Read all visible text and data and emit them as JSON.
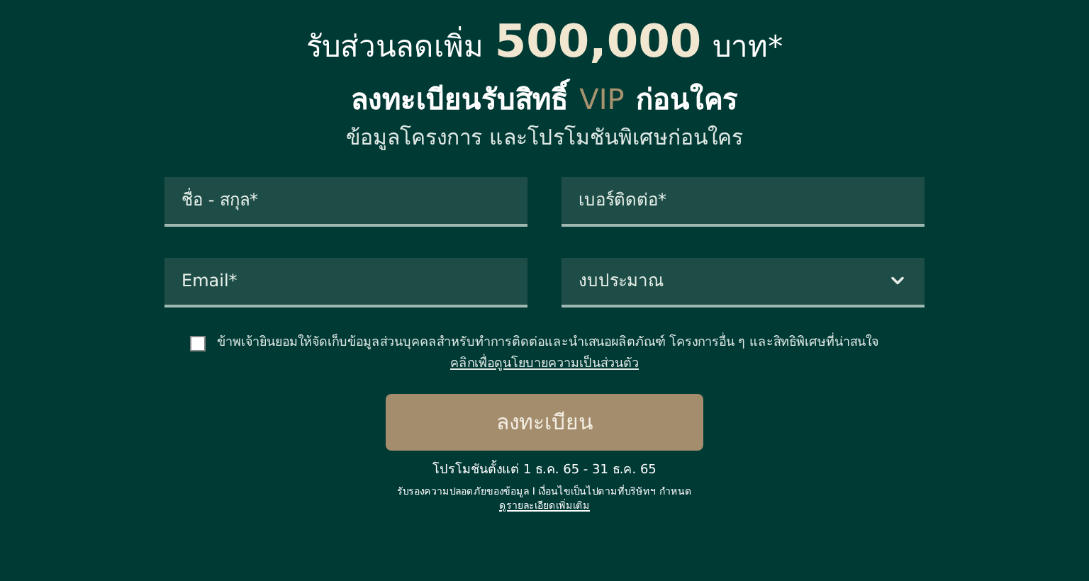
{
  "headline": {
    "prefix": "รับส่วนลดเพิ่ม",
    "amount": "500,000",
    "suffix": "บาท*"
  },
  "subheadline": {
    "prefix": "ลงทะเบียนรับสิทธิ์",
    "highlight": "VIP",
    "suffix": "ก่อนใคร"
  },
  "tagline": "ข้อมูลโครงการ และโปรโมชันพิเศษก่อนใคร",
  "fields": [
    {
      "kind": "input",
      "placeholder": "ชื่อ - สกุล*"
    },
    {
      "kind": "input",
      "placeholder": "เบอร์ติดต่อ*"
    },
    {
      "kind": "input",
      "placeholder": "Email*"
    },
    {
      "kind": "select",
      "value": "งบประมาณ"
    }
  ],
  "consent": {
    "checked": false,
    "text": "ข้าพเจ้ายินยอมให้จัดเก็บข้อมูลส่วนบุคคลสำหรับทำการติดต่อและนำเสนอผลิตภัณฑ์ โครงการอื่น ๆ และสิทธิพิเศษที่น่าสนใจ",
    "link": "คลิกเพื่อดูนโยบายความเป็นส่วนตัว"
  },
  "submit_button": "ลงทะเบียน",
  "promo_period": "โปรโมชันตั้งแต่ 1 ธ.ค. 65 - 31 ธ.ค. 65",
  "disclaimer": "รับรองความปลอดภัยของข้อมูล I เงื่อนไขเป็นไปตามที่บริษัทฯ กำหนด",
  "details_link": "ดูรายละเอียดเพิ่มเติม"
}
